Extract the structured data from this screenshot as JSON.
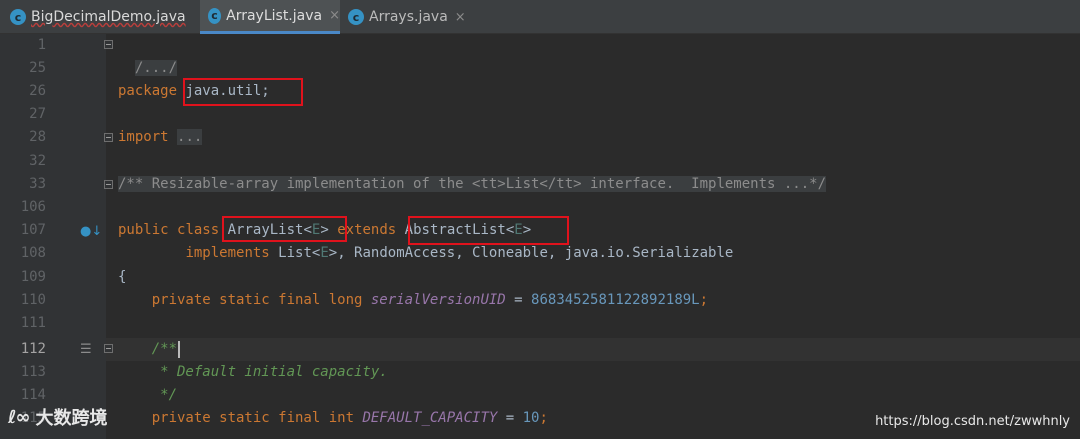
{
  "tabs": [
    {
      "label": "BigDecimalDemo.java",
      "icon_letter": "c"
    },
    {
      "label": "ArrayList.java",
      "icon_letter": "c"
    },
    {
      "label": "Arrays.java",
      "icon_letter": "c"
    }
  ],
  "tab_close_glyph": "×",
  "line_numbers": [
    "1",
    "25",
    "26",
    "27",
    "28",
    "32",
    "33",
    "106",
    "107",
    "108",
    "109",
    "110",
    "111",
    "112",
    "113",
    "114",
    "115"
  ],
  "code": {
    "l1": "/.../",
    "l26_kw": "package",
    "l26_pkg": "java.util;",
    "l28_kw": "import",
    "l28_fold": "...",
    "l33": "/** Resizable-array implementation of the <tt>List</tt> interface.  Implements ...*/",
    "l107_public": "public",
    "l107_class": "class",
    "l107_name": "ArrayList<",
    "l107_E": "E",
    "l107_close": ">",
    "l107_extends": "extends",
    "l107_super": "AbstractList<",
    "l107_E2": "E",
    "l107_close2": ">",
    "l108_implements": "implements",
    "l108_list": "List<",
    "l108_E": "E",
    "l108_rest": ">, RandomAccess, Cloneable, java.io.Serializable",
    "l109": "{",
    "l110_kw": "private static final long",
    "l110_field": "serialVersionUID",
    "l110_eq": " = ",
    "l110_num": "8683452581122892189L",
    "l110_semi": ";",
    "l112": "/**",
    "l113": " * Default initial capacity.",
    "l114": " */",
    "l115_kw": "private static final int",
    "l115_field": "DEFAULT_CAPACITY",
    "l115_eq": " = ",
    "l115_num": "10",
    "l115_semi": ";"
  },
  "watermark": {
    "logo": "ℓ∞",
    "brand": "大数跨境",
    "url": "https://blog.csdn.net/zwwhnly"
  },
  "colors": {
    "keyword": "#cc7832",
    "comment": "#808080",
    "doc_comment": "#629755",
    "number": "#6897bb",
    "field": "#9876aa",
    "type_param": "#507874",
    "annotation_box": "#e0121c"
  }
}
